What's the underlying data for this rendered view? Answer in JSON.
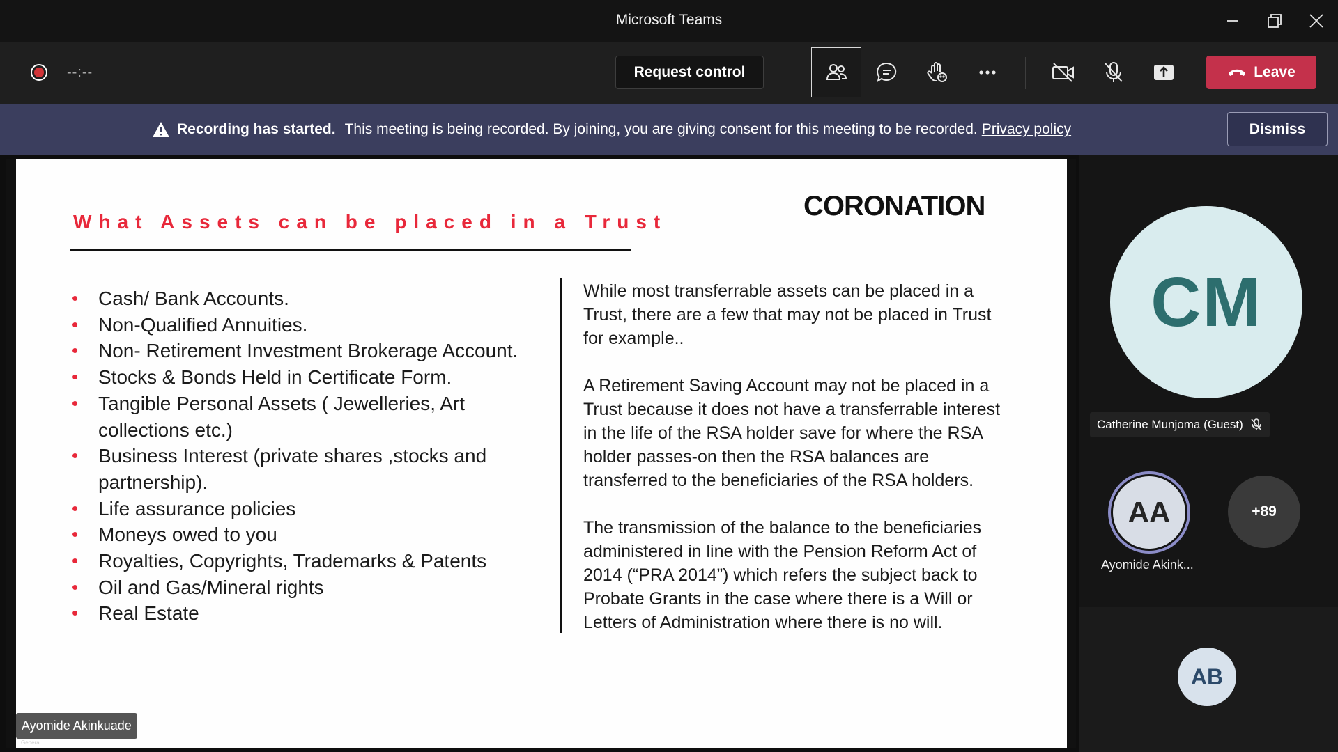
{
  "window": {
    "title": "Microsoft Teams"
  },
  "toolbar": {
    "timer": "--:--",
    "request_control_label": "Request control",
    "leave_label": "Leave"
  },
  "banner": {
    "bold": "Recording has started.",
    "text": "This meeting is being recorded. By joining, you are giving consent for this meeting to be recorded.",
    "link": "Privacy policy",
    "dismiss_label": "Dismiss"
  },
  "slide": {
    "title": "What Assets can be placed in a Trust",
    "brand": "CORONATION",
    "bullets": [
      "Cash/ Bank Accounts.",
      "Non-Qualified Annuities.",
      "Non- Retirement Investment Brokerage Account.",
      "Stocks & Bonds Held in Certificate Form.",
      "Tangible Personal Assets ( Jewelleries, Art collections etc.)",
      "Business Interest (private shares ,stocks and partnership).",
      "Life assurance policies",
      "Moneys owed to you",
      "Royalties, Copyrights, Trademarks & Patents",
      "Oil and Gas/Mineral rights",
      "Real Estate"
    ],
    "paragraphs": [
      "While most transferrable assets can be placed in a Trust, there are a few that may not be placed in Trust for example..",
      "A Retirement Saving Account may not be placed in a Trust because it does not have a transferrable interest in the life of the RSA holder save for where the RSA holder passes-on then the RSA balances are transferred to the beneficiaries of the RSA holders.",
      "The transmission of the balance to the beneficiaries administered in line with the Pension Reform Act of 2014 (“PRA 2014”) which  refers the subject back to Probate Grants in the case where there is a Will or Letters of Administration where there is no will."
    ]
  },
  "presenter": {
    "name": "Ayomide Akinkuade",
    "sublabel": "General"
  },
  "participants": {
    "featured": {
      "initials": "CM",
      "name": "Catherine Munjoma (Guest)",
      "avatar_bg": "#d9ecee"
    },
    "speaker": {
      "initials": "AA",
      "name": "Ayomide Akink...",
      "ring_color": "#8b8cc7"
    },
    "overflow_count": "+89",
    "other": {
      "initials": "AB"
    }
  },
  "colors": {
    "leave": "#c4314b",
    "banner": "#3b3e5e",
    "slide_title": "#e8283a"
  }
}
